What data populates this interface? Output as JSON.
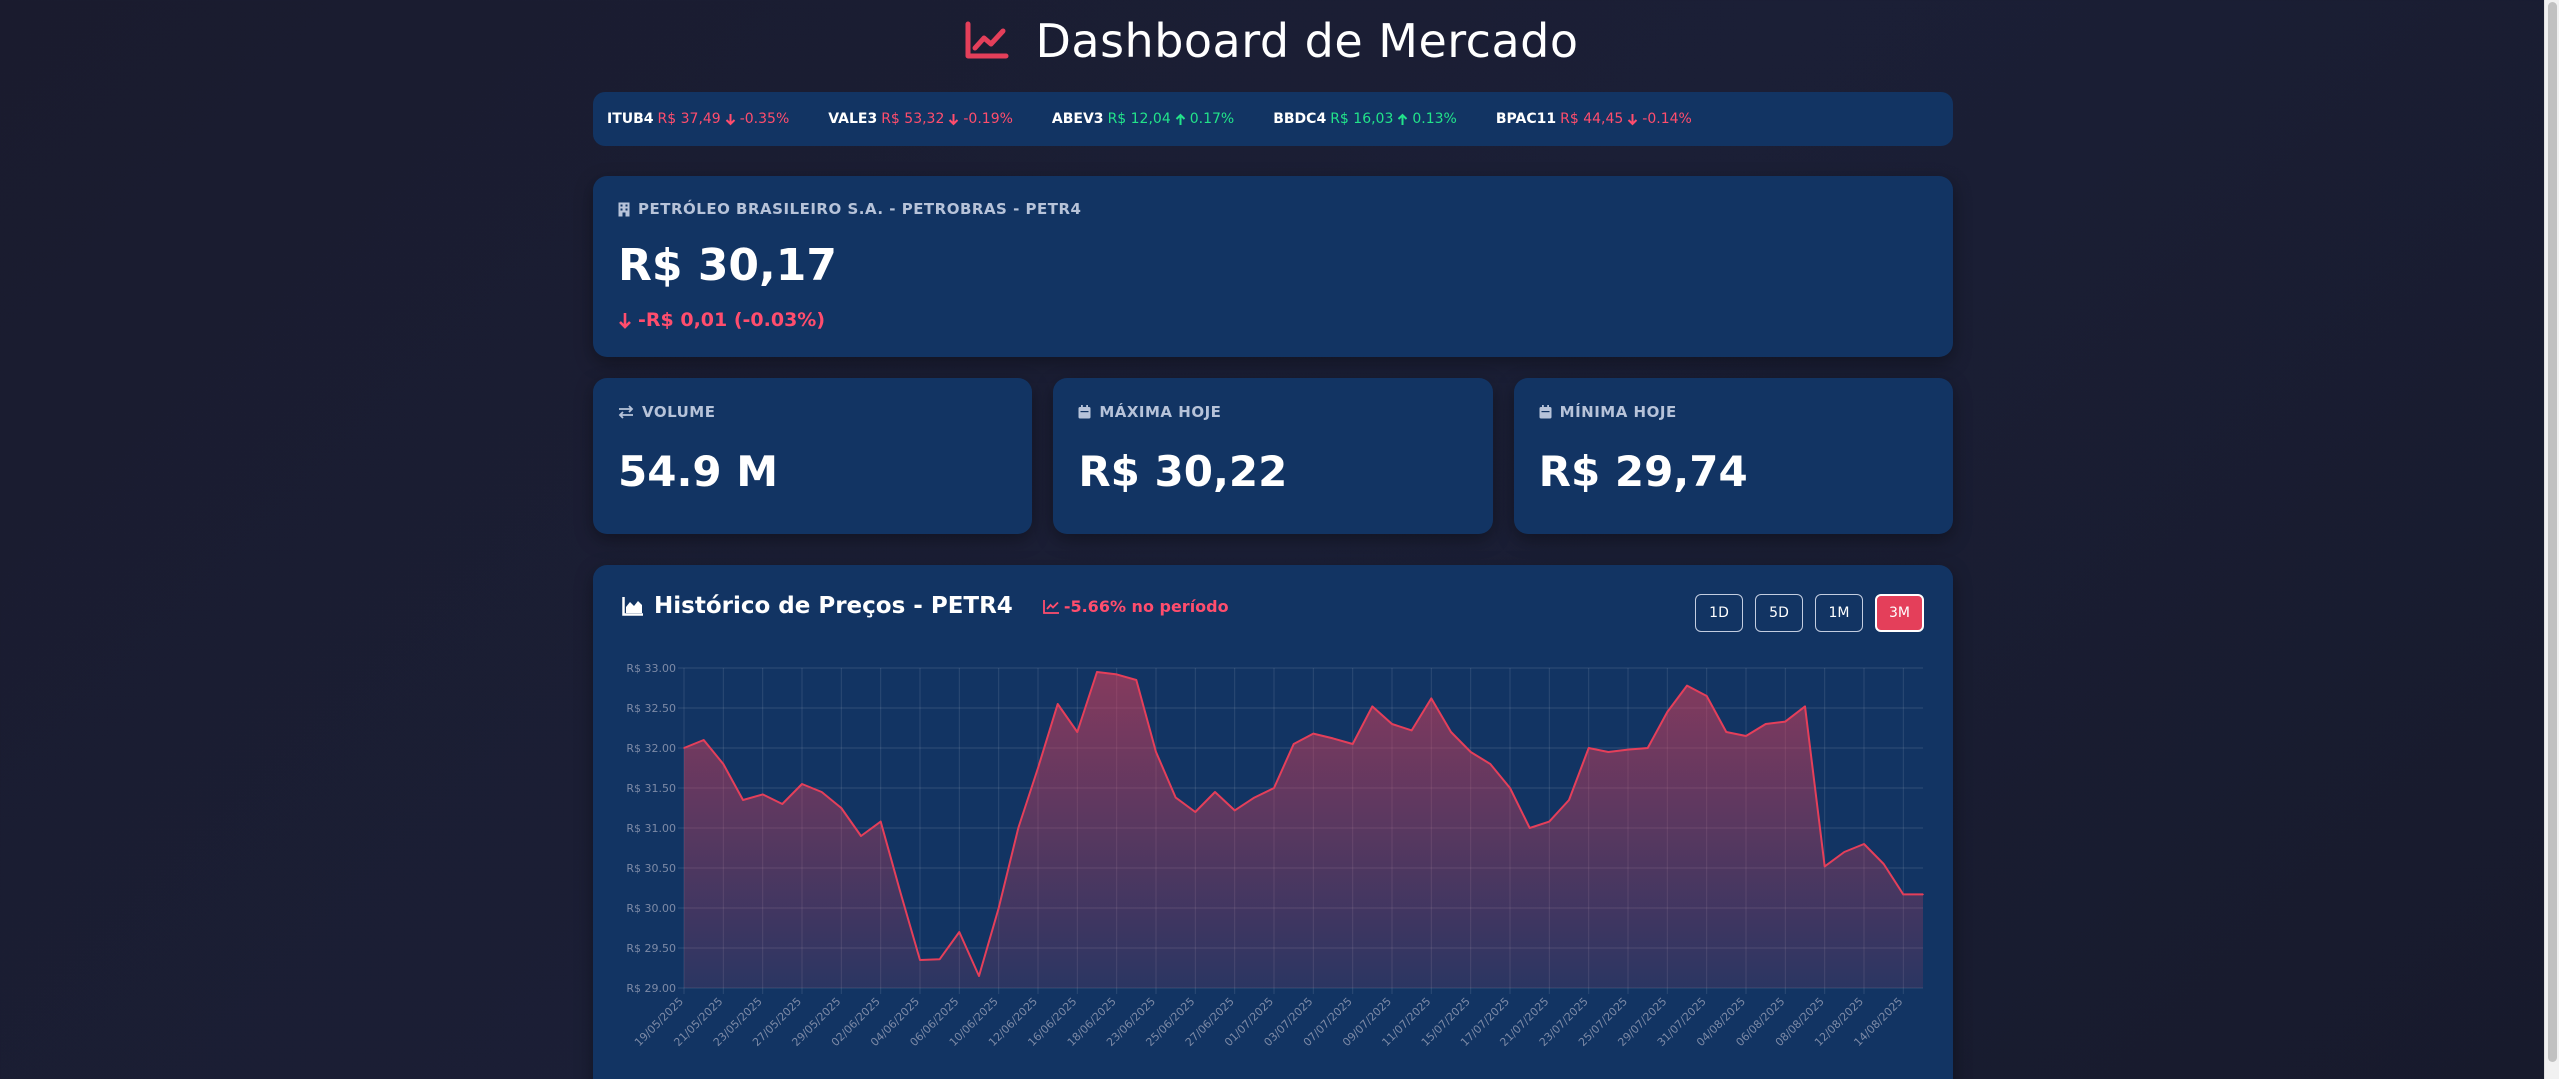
{
  "header": {
    "title": "Dashboard de Mercado",
    "icon": "chart-line-icon"
  },
  "ticker": [
    {
      "symbol": "ITUB4",
      "price": "R$ 37,49",
      "change": "-0.35%",
      "direction": "down"
    },
    {
      "symbol": "VALE3",
      "price": "R$ 53,32",
      "change": "-0.19%",
      "direction": "down"
    },
    {
      "symbol": "ABEV3",
      "price": "R$ 12,04",
      "change": "0.17%",
      "direction": "up"
    },
    {
      "symbol": "BBDC4",
      "price": "R$ 16,03",
      "change": "0.13%",
      "direction": "up"
    },
    {
      "symbol": "BPAC11",
      "price": "R$ 44,45",
      "change": "-0.14%",
      "direction": "down"
    }
  ],
  "stock": {
    "name": "PETRÓLEO BRASILEIRO S.A. - PETROBRAS - PETR4",
    "price": "R$ 30,17",
    "change": "-R$ 0,01 (-0.03%)"
  },
  "stats": {
    "volume": {
      "label": "VOLUME",
      "value": "54.9 M"
    },
    "high": {
      "label": "MÁXIMA HOJE",
      "value": "R$ 30,22"
    },
    "low": {
      "label": "MÍNIMA HOJE",
      "value": "R$ 29,74"
    }
  },
  "chart": {
    "title": "Histórico de Preços - PETR4",
    "performance": "-5.66% no período",
    "ranges": [
      "1D",
      "5D",
      "1M",
      "3M"
    ],
    "active_range": "3M"
  },
  "colors": {
    "accent": "#e43f5a",
    "card": "#123463",
    "negative": "#ff4d6d",
    "positive": "#22e38a"
  },
  "chart_data": {
    "type": "area",
    "title": "Histórico de Preços - PETR4",
    "ylim": [
      29.0,
      33.0
    ],
    "y_ticks": [
      "R$ 33.00",
      "R$ 32.50",
      "R$ 32.00",
      "R$ 31.50",
      "R$ 31.00",
      "R$ 30.50",
      "R$ 30.00",
      "R$ 29.50",
      "R$ 29.00"
    ],
    "x_labels": [
      "19/05/2025",
      "21/05/2025",
      "23/05/2025",
      "27/05/2025",
      "29/05/2025",
      "02/06/2025",
      "04/06/2025",
      "06/06/2025",
      "10/06/2025",
      "12/06/2025",
      "16/06/2025",
      "18/06/2025",
      "23/06/2025",
      "25/06/2025",
      "27/06/2025",
      "01/07/2025",
      "03/07/2025",
      "07/07/2025",
      "09/07/2025",
      "11/07/2025",
      "15/07/2025",
      "17/07/2025",
      "21/07/2025",
      "23/07/2025",
      "25/07/2025",
      "29/07/2025",
      "31/07/2025",
      "04/08/2025",
      "06/08/2025",
      "08/08/2025",
      "12/08/2025",
      "14/08/2025"
    ],
    "values": [
      32.0,
      32.1,
      31.8,
      31.35,
      31.42,
      31.3,
      31.55,
      31.45,
      31.25,
      30.9,
      31.08,
      30.2,
      29.35,
      29.36,
      29.7,
      29.15,
      30.0,
      31.0,
      31.75,
      32.55,
      32.2,
      32.95,
      32.92,
      32.85,
      31.95,
      31.38,
      31.2,
      31.45,
      31.22,
      31.38,
      31.5,
      32.05,
      32.18,
      32.12,
      32.05,
      32.52,
      32.3,
      32.22,
      32.62,
      32.2,
      31.95,
      31.8,
      31.5,
      31.0,
      31.08,
      31.35,
      32.0,
      31.95,
      31.98,
      32.0,
      32.45,
      32.78,
      32.65,
      32.2,
      32.15,
      32.3,
      32.33,
      32.52,
      30.52,
      30.7,
      30.8,
      30.55,
      30.17,
      30.17
    ],
    "series": [
      {
        "values_ref": "values",
        "color": "#e43f5a"
      }
    ],
    "grid": true
  }
}
